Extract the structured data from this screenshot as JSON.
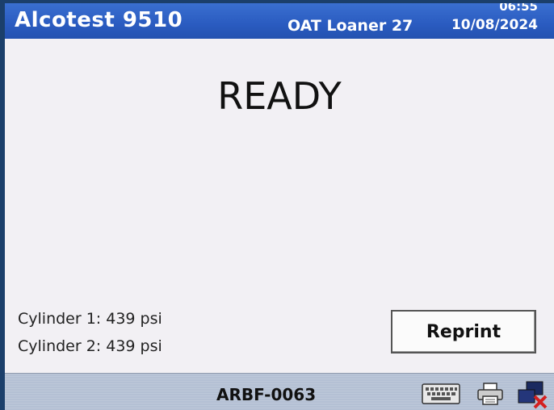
{
  "title_bar": {
    "app_title": "Alcotest 9510",
    "device_name": "OAT Loaner 27",
    "time": "06:55",
    "date": "10/08/2024"
  },
  "main": {
    "status": "READY",
    "cylinders": [
      "Cylinder 1: 439 psi",
      "Cylinder 2: 439 psi"
    ],
    "reprint_label": "Reprint"
  },
  "taskbar": {
    "serial": "ARBF-0063",
    "icons": [
      "keyboard-icon",
      "printer-icon",
      "network-disconnected-icon"
    ]
  },
  "colors": {
    "title_bar": "#2a5bc0",
    "screen_background": "#f2f0f4",
    "taskbar": "#b4c0d4"
  }
}
